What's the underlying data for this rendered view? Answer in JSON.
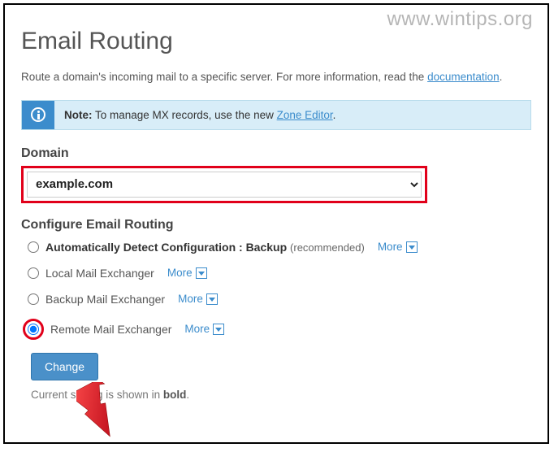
{
  "watermark": "www.wintips.org",
  "page_title": "Email Routing",
  "intro_prefix": "Route a domain's incoming mail to a specific server. For more information, read the ",
  "intro_link": "documentation",
  "intro_suffix": ".",
  "note": {
    "label": "Note:",
    "text_before": " To manage MX records, use the new ",
    "link": "Zone Editor",
    "text_after": "."
  },
  "domain": {
    "label": "Domain",
    "selected": "example.com"
  },
  "configure_label": "Configure Email Routing",
  "options": {
    "auto": {
      "label": "Automatically Detect Configuration : Backup",
      "recommended": "(recommended)",
      "more": "More"
    },
    "local": {
      "label": "Local Mail Exchanger",
      "more": "More"
    },
    "backup": {
      "label": "Backup Mail Exchanger",
      "more": "More"
    },
    "remote": {
      "label": "Remote Mail Exchanger",
      "more": "More"
    }
  },
  "change_button": "Change",
  "current_note_prefix": "Current setting is shown in ",
  "current_note_bold": "bold",
  "current_note_suffix": "."
}
